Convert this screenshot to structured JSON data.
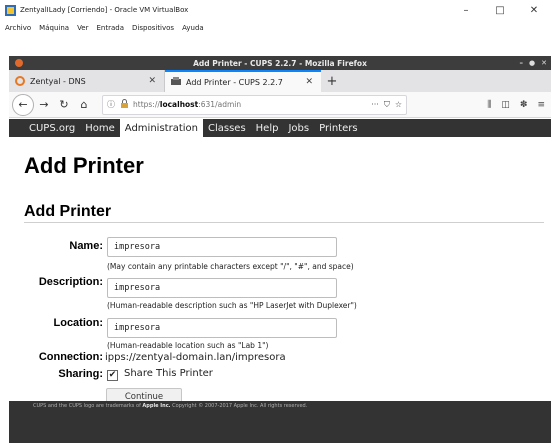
{
  "vbox": {
    "title": "ZentyalILady [Corriendo] - Oracle VM VirtualBox",
    "menu": [
      "Archivo",
      "Máquina",
      "Ver",
      "Entrada",
      "Dispositivos",
      "Ayuda"
    ],
    "controls": {
      "minimize": "–",
      "maximize": "□",
      "close": "✕"
    }
  },
  "firefox": {
    "window_title": "Add Printer - CUPS 2.2.7 - Mozilla Firefox",
    "tabs": [
      {
        "label": "Zentyal - DNS",
        "icon": "zentyal-icon",
        "active": false
      },
      {
        "label": "Add Printer - CUPS 2.2.7",
        "icon": "cups-icon",
        "active": true
      }
    ],
    "new_tab": "+",
    "url_prefix": "https://",
    "url_host": "localhost",
    "url_rest": ":631/admin",
    "icons": {
      "back": "back-icon",
      "forward": "forward-icon",
      "reload": "reload-icon",
      "home": "home-icon",
      "page_info": "info-icon",
      "lock": "lock-icon",
      "more": "more-icon",
      "pocket": "pocket-icon",
      "bookmark": "star-icon",
      "library": "library-icon",
      "sidebar": "sidebar-icon",
      "extension": "extension-icon",
      "menu": "hamburger-menu-icon"
    },
    "colors": {
      "tab_accent": "#0a84ff",
      "title_bar": "#3d3d3d"
    }
  },
  "cups": {
    "nav": [
      "CUPS.org",
      "Home",
      "Administration",
      "Classes",
      "Help",
      "Jobs",
      "Printers"
    ],
    "active_nav": "Administration",
    "page_title": "Add Printer",
    "section_title": "Add Printer",
    "form": {
      "name_label": "Name:",
      "name_value": "impresora",
      "name_hint": "(May contain any printable characters except \"/\", \"#\", and space)",
      "description_label": "Description:",
      "description_value": "impresora",
      "description_hint": "(Human-readable description such as \"HP LaserJet with Duplexer\")",
      "location_label": "Location:",
      "location_value": "impresora",
      "location_hint": "(Human-readable location such as \"Lab 1\")",
      "connection_label": "Connection:",
      "connection_value": "ipps://zentyal-domain.lan/impresora",
      "sharing_label": "Sharing:",
      "sharing_checked": true,
      "sharing_text": "Share This Printer",
      "continue_label": "Continue"
    },
    "footer_prefix": "CUPS and the CUPS logo are trademarks of ",
    "footer_brand": "Apple Inc.",
    "footer_suffix": " Copyright © 2007-2017 Apple Inc. All rights reserved.",
    "colors": {
      "header_bg": "#333333",
      "footer_bg": "#333333"
    }
  }
}
